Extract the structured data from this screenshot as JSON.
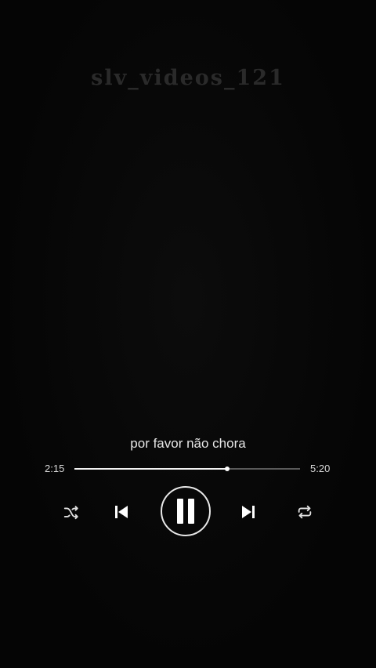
{
  "watermark": "slv_videos_121",
  "player": {
    "title": "por favor não chora",
    "elapsed": "2:15",
    "duration": "5:20",
    "progress_fraction": 0.677,
    "colors": {
      "background": "#050505",
      "track": "#5a5a5a",
      "fill": "#f2f2f2",
      "text": "#e6e6e6"
    }
  },
  "controls": {
    "shuffle": "shuffle-icon",
    "previous": "skip-previous-icon",
    "play_pause": "pause-icon",
    "next": "skip-next-icon",
    "repeat": "repeat-icon"
  }
}
